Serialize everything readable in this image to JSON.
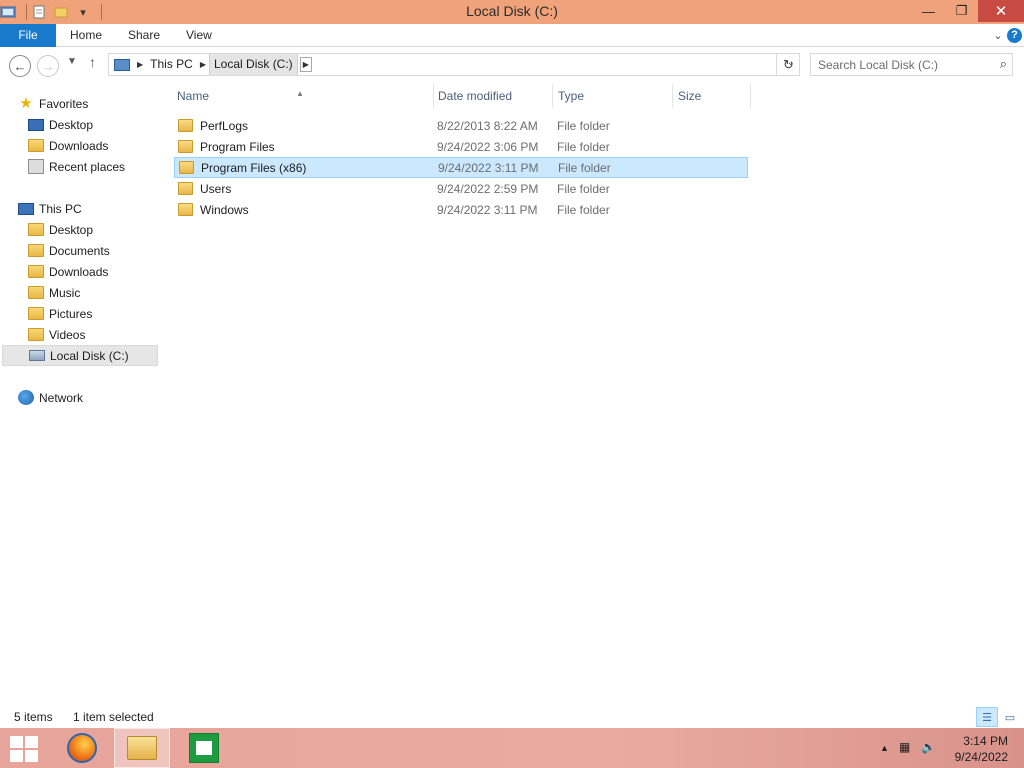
{
  "window": {
    "title": "Local Disk (C:)"
  },
  "ribbon": {
    "file": "File",
    "tabs": [
      "Home",
      "Share",
      "View"
    ],
    "help": "?"
  },
  "nav": {
    "breadcrumb": [
      "This PC",
      "Local Disk (C:)"
    ],
    "search_placeholder": "Search Local Disk (C:)"
  },
  "sidebar": {
    "favorites_label": "Favorites",
    "favorites": [
      "Desktop",
      "Downloads",
      "Recent places"
    ],
    "thispc_label": "This PC",
    "thispc": [
      "Desktop",
      "Documents",
      "Downloads",
      "Music",
      "Pictures",
      "Videos",
      "Local Disk (C:)"
    ],
    "network_label": "Network",
    "selected": "Local Disk (C:)"
  },
  "list": {
    "columns": [
      "Name",
      "Date modified",
      "Type",
      "Size"
    ],
    "rows": [
      {
        "name": "PerfLogs",
        "date": "8/22/2013 8:22 AM",
        "type": "File folder",
        "selected": false
      },
      {
        "name": "Program Files",
        "date": "9/24/2022 3:06 PM",
        "type": "File folder",
        "selected": false
      },
      {
        "name": "Program Files (x86)",
        "date": "9/24/2022 3:11 PM",
        "type": "File folder",
        "selected": true
      },
      {
        "name": "Users",
        "date": "9/24/2022 2:59 PM",
        "type": "File folder",
        "selected": false
      },
      {
        "name": "Windows",
        "date": "9/24/2022 3:11 PM",
        "type": "File folder",
        "selected": false
      }
    ]
  },
  "status": {
    "item_count": "5 items",
    "selection": "1 item selected"
  },
  "taskbar": {
    "apps": [
      "firefox-icon",
      "file-explorer-icon",
      "store-icon"
    ],
    "time": "3:14 PM",
    "date": "9/24/2022"
  },
  "colors": {
    "titlebar": "#f0a37a",
    "accent": "#1979ca",
    "selection": "#cce8ff",
    "close": "#c74b42"
  }
}
